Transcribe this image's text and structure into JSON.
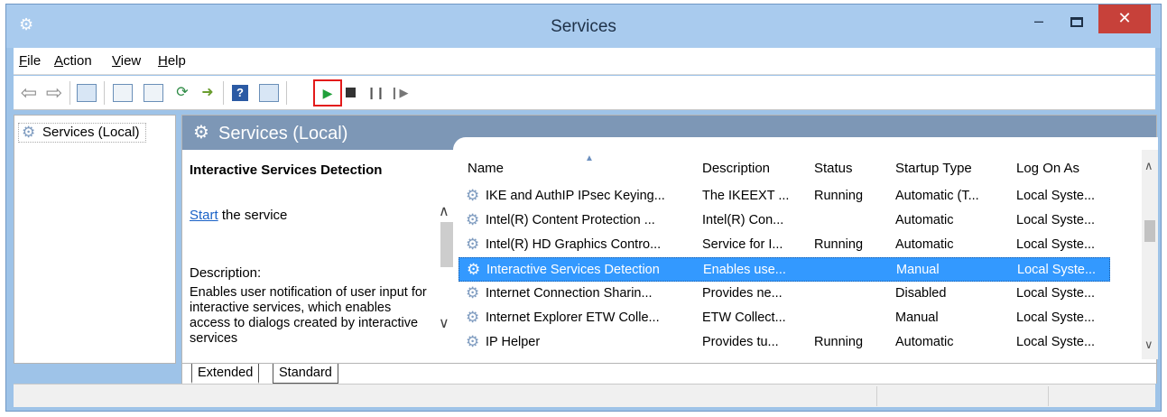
{
  "window": {
    "title": "Services",
    "minimize_glyph": "–",
    "close_glyph": "✕"
  },
  "menu": {
    "file": "File",
    "action": "Action",
    "view": "View",
    "help": "Help"
  },
  "toolbar": {
    "icons": [
      "back-arrow-icon",
      "forward-arrow-icon",
      "show-hide-console-tree-icon",
      "properties-icon",
      "refresh-icon",
      "export-list-icon",
      "help-icon",
      "show-hide-action-pane-icon",
      "start-service-icon",
      "stop-service-icon",
      "pause-service-icon",
      "resume-service-icon"
    ],
    "highlight_color": "#e31a1a"
  },
  "tree": {
    "root_label": "Services (Local)"
  },
  "content": {
    "header_title": "Services (Local)",
    "extended": {
      "service_title": "Interactive Services Detection",
      "start_link": "Start",
      "start_suffix": " the service",
      "description_label": "Description:",
      "description_text": "Enables user notification of user input for interactive services, which enables access to dialogs created by interactive services"
    },
    "table": {
      "columns": [
        "Name",
        "Description",
        "Status",
        "Startup Type",
        "Log On As"
      ],
      "rows": [
        {
          "name": "IKE and AuthIP IPsec Keying...",
          "description": "The IKEEXT ...",
          "status": "Running",
          "startup": "Automatic (T...",
          "logon": "Local Syste..."
        },
        {
          "name": "Intel(R) Content Protection ...",
          "description": "Intel(R) Con...",
          "status": "",
          "startup": "Automatic",
          "logon": "Local Syste..."
        },
        {
          "name": "Intel(R) HD Graphics Contro...",
          "description": "Service for I...",
          "status": "Running",
          "startup": "Automatic",
          "logon": "Local Syste..."
        },
        {
          "name": "Interactive Services Detection",
          "description": "Enables use...",
          "status": "",
          "startup": "Manual",
          "logon": "Local Syste..."
        },
        {
          "name": "Internet Connection Sharin...",
          "description": "Provides ne...",
          "status": "",
          "startup": "Disabled",
          "logon": "Local Syste..."
        },
        {
          "name": "Internet Explorer ETW Colle...",
          "description": "ETW Collect...",
          "status": "",
          "startup": "Manual",
          "logon": "Local Syste..."
        },
        {
          "name": "IP Helper",
          "description": "Provides tu...",
          "status": "Running",
          "startup": "Automatic",
          "logon": "Local Syste..."
        }
      ],
      "selected_row_index": 3,
      "selected_color": "#3399ff"
    }
  },
  "tabs": {
    "extended": "Extended",
    "standard": "Standard"
  }
}
